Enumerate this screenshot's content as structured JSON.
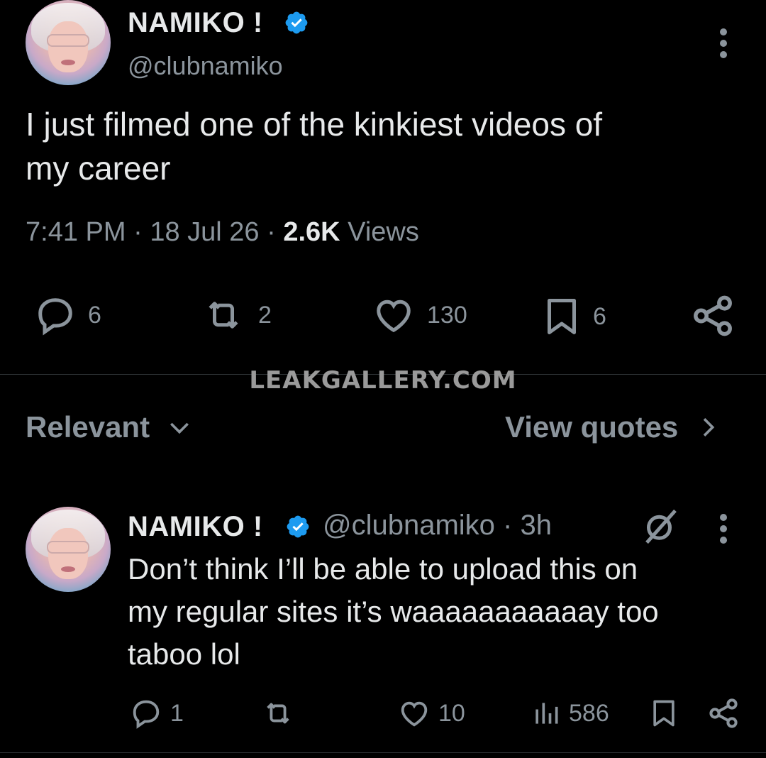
{
  "main_tweet": {
    "author_name": "NAMIKO !",
    "handle": "@clubnamiko",
    "text_line1": "I just filmed one of the kinkiest videos of",
    "text_line2": "my career",
    "time": "7:41 PM",
    "date": "18 Jul 26",
    "views_count": "2.6K",
    "views_label": "Views",
    "actions": {
      "replies": "6",
      "reposts": "2",
      "likes": "130",
      "bookmarks": "6"
    }
  },
  "watermark": "LEAKGALLERY.COM",
  "sort_bar": {
    "sort_label": "Relevant",
    "view_quotes_label": "View quotes"
  },
  "reply": {
    "author_name": "NAMIKO !",
    "handle_time": "@clubnamiko · 3h",
    "text_line1": "Don’t think I’ll be able to upload this on",
    "text_line2": "my regular sites it’s waaaaaaaaaaay too",
    "text_line3": "taboo lol",
    "actions": {
      "replies": "1",
      "likes": "10",
      "views": "586"
    }
  },
  "colors": {
    "background": "#000000",
    "text_primary": "#e7e9ea",
    "text_secondary": "#8b949c",
    "verified_blue": "#1d9bf0"
  },
  "icons": [
    "reply-icon",
    "repost-icon",
    "like-icon",
    "bookmark-icon",
    "share-icon",
    "verified-icon",
    "more-icon",
    "chevron-down-icon",
    "chevron-right-icon",
    "grok-icon",
    "views-icon"
  ]
}
